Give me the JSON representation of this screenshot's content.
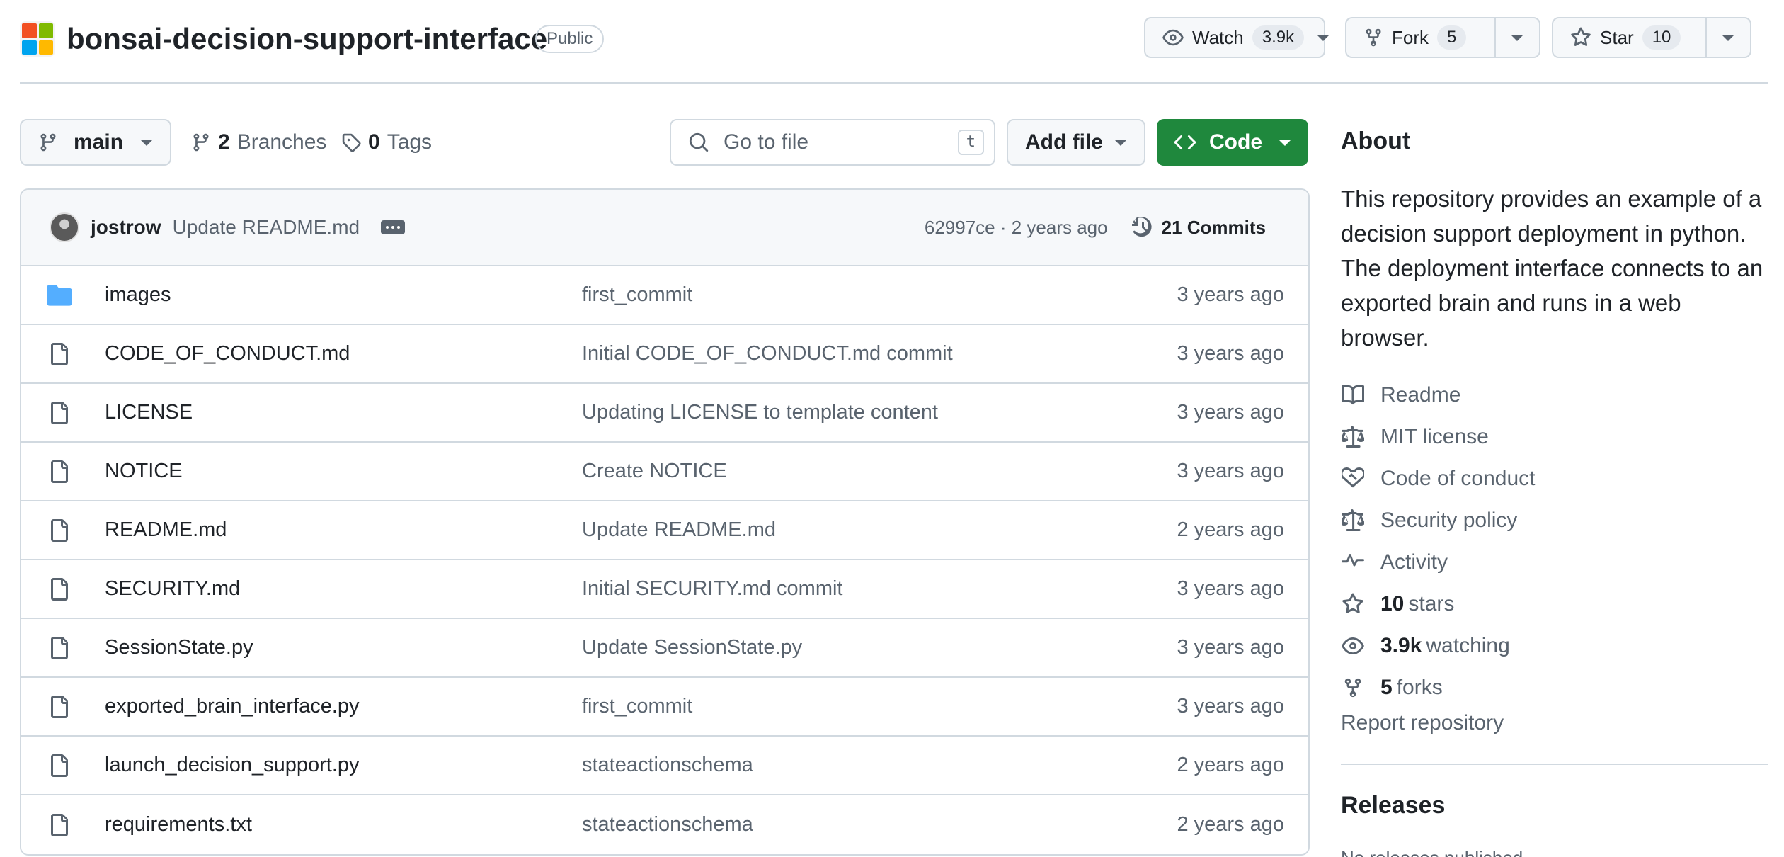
{
  "repo": {
    "name": "bonsai-decision-support-interface",
    "visibility": "Public",
    "logo_colors": [
      "#f25022",
      "#7fba00",
      "#00a4ef",
      "#ffb900"
    ]
  },
  "header_actions": {
    "watch": {
      "label": "Watch",
      "count": "3.9k"
    },
    "fork": {
      "label": "Fork",
      "count": "5"
    },
    "star": {
      "label": "Star",
      "count": "10"
    }
  },
  "toolbar": {
    "branch": "main",
    "branches": {
      "count": "2",
      "label": "Branches"
    },
    "tags": {
      "count": "0",
      "label": "Tags"
    },
    "search_placeholder": "Go to file",
    "search_shortcut": "t",
    "add_file": "Add file",
    "code": "Code"
  },
  "latest_commit": {
    "user": "jostrow",
    "message": "Update README.md",
    "meta": "62997ce · 2 years ago",
    "commits_label": "21 Commits"
  },
  "files": [
    {
      "name": "images",
      "type": "folder",
      "message": "first_commit",
      "date": "3 years ago"
    },
    {
      "name": "CODE_OF_CONDUCT.md",
      "type": "file",
      "message": "Initial CODE_OF_CONDUCT.md commit",
      "date": "3 years ago"
    },
    {
      "name": "LICENSE",
      "type": "file",
      "message": "Updating LICENSE to template content",
      "date": "3 years ago"
    },
    {
      "name": "NOTICE",
      "type": "file",
      "message": "Create NOTICE",
      "date": "3 years ago"
    },
    {
      "name": "README.md",
      "type": "file",
      "message": "Update README.md",
      "date": "2 years ago"
    },
    {
      "name": "SECURITY.md",
      "type": "file",
      "message": "Initial SECURITY.md commit",
      "date": "3 years ago"
    },
    {
      "name": "SessionState.py",
      "type": "file",
      "message": "Update SessionState.py",
      "date": "3 years ago"
    },
    {
      "name": "exported_brain_interface.py",
      "type": "file",
      "message": "first_commit",
      "date": "3 years ago"
    },
    {
      "name": "launch_decision_support.py",
      "type": "file",
      "message": "stateactionschema",
      "date": "2 years ago"
    },
    {
      "name": "requirements.txt",
      "type": "file",
      "message": "stateactionschema",
      "date": "2 years ago"
    }
  ],
  "about": {
    "title": "About",
    "description": "This repository provides an example of a decision support deployment in python. The deployment interface connects to an exported brain and runs in a web browser.",
    "links": {
      "readme": "Readme",
      "license": "MIT license",
      "conduct": "Code of conduct",
      "security": "Security policy",
      "activity": "Activity",
      "stars": {
        "count": "10",
        "label": "stars"
      },
      "watching": {
        "count": "3.9k",
        "label": "watching"
      },
      "forks": {
        "count": "5",
        "label": "forks"
      }
    },
    "report": "Report repository"
  },
  "releases": {
    "title": "Releases",
    "empty": "No releases published"
  },
  "colors": {
    "accent_green": "#1f883d",
    "folder_blue": "#54aeff",
    "muted_text": "#59636e",
    "border": "#d1d9e0"
  }
}
